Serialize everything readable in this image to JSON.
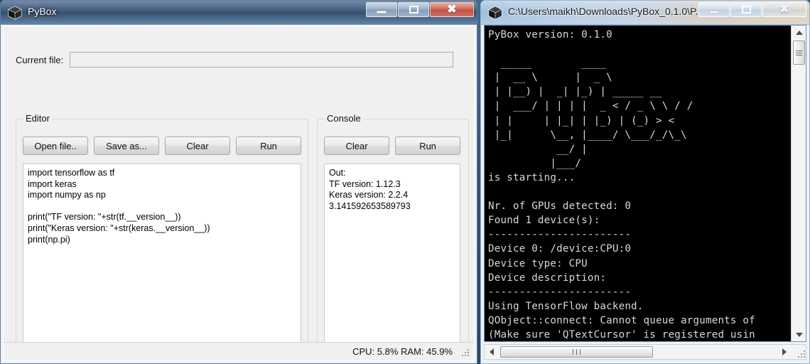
{
  "pybox_window": {
    "title": "PyBox",
    "icon": "cube-icon",
    "window_buttons": {
      "minimize": "minimize-icon",
      "maximize": "maximize-icon",
      "close": "close-icon",
      "close_color": "#b23a2b"
    },
    "current_file": {
      "label": "Current file:",
      "value": "",
      "placeholder": ""
    },
    "editor": {
      "group_title": "Editor",
      "buttons": [
        {
          "label": "Open file..",
          "name": "open-file-button"
        },
        {
          "label": "Save as...",
          "name": "save-as-button"
        },
        {
          "label": "Clear",
          "name": "clear-editor-button"
        },
        {
          "label": "Run",
          "name": "run-editor-button"
        }
      ],
      "code": "import tensorflow as tf\nimport keras\nimport numpy as np\n\nprint(\"TF version: \"+str(tf.__version__))\nprint(\"Keras version: \"+str(keras.__version__))\nprint(np.pi)"
    },
    "console": {
      "group_title": "Console",
      "buttons": [
        {
          "label": "Clear",
          "name": "clear-console-button"
        },
        {
          "label": "Run",
          "name": "run-console-button"
        }
      ],
      "output": "Out:\nTF version: 1.12.3\nKeras version: 2.2.4\n3.141592653589793"
    },
    "statusbar": {
      "text": "CPU: 5.8%  RAM: 45.9%",
      "cpu": "CPU: 5.8%",
      "ram": "RAM: 45.9%"
    }
  },
  "terminal_window": {
    "title": "C:\\Users\\maikh\\Downloads\\PyBox_0.1.0\\P...",
    "icon": "cube-icon",
    "window_buttons": {
      "minimize": "minimize-icon",
      "maximize": "maximize-icon",
      "close": "close-icon"
    },
    "console_text": "PyBox version: 0.1.0\n\n  _____        ____\n |  __ \\      |  _ \\\n | |__) |  _| |_) | _____ __\n |  ___/ | | | |  _ < / _ \\ \\ / /\n | |     | |_| | |_) | (_) > <\n |_|      \\__, |____/ \\___/_/\\_\\\n           __/ |\n          |___/\nis starting...\n\nNr. of GPUs detected: 0\nFound 1 device(s):\n-----------------------\nDevice 0: /device:CPU:0\nDevice type: CPU\nDevice description:\n-----------------------\nUsing TensorFlow backend.\nQObject::connect: Cannot queue arguments of\n(Make sure 'QTextCursor' is registered usin",
    "scrollbars": {
      "vertical": "vertical-scrollbar",
      "horizontal": "horizontal-scrollbar"
    }
  }
}
